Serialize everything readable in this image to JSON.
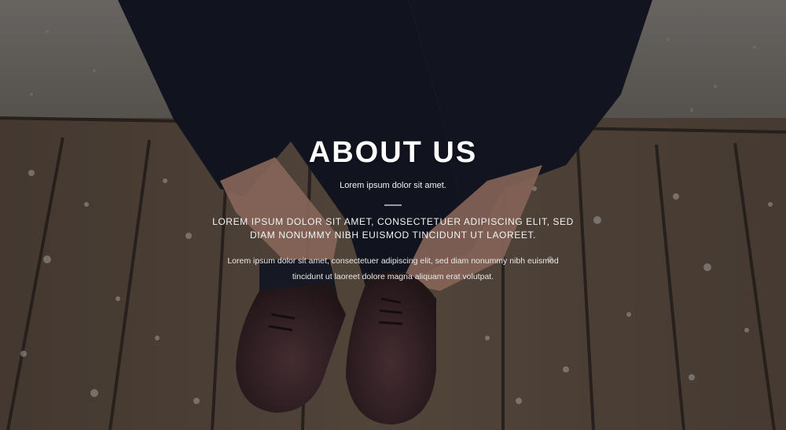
{
  "hero": {
    "title": "ABOUT US",
    "subtitle": "Lorem ipsum dolor sit amet.",
    "heading": "LOREM IPSUM DOLOR SIT AMET, CONSECTETUER ADIPISCING ELIT, SED DIAM NONUMMY NIBH EUISMOD TINCIDUNT UT LAOREET.",
    "body": "Lorem ipsum dolor sit amet, consectetuer adipiscing elit, sed diam nonummy nibh euismod tincidunt ut laoreet dolore magna aliquam erat volutpat."
  },
  "colors": {
    "text": "#ffffff",
    "divider": "#9a9a9a",
    "trousers": "#141824",
    "shoes": "#3a2226",
    "deck": "#6b5a4a"
  }
}
